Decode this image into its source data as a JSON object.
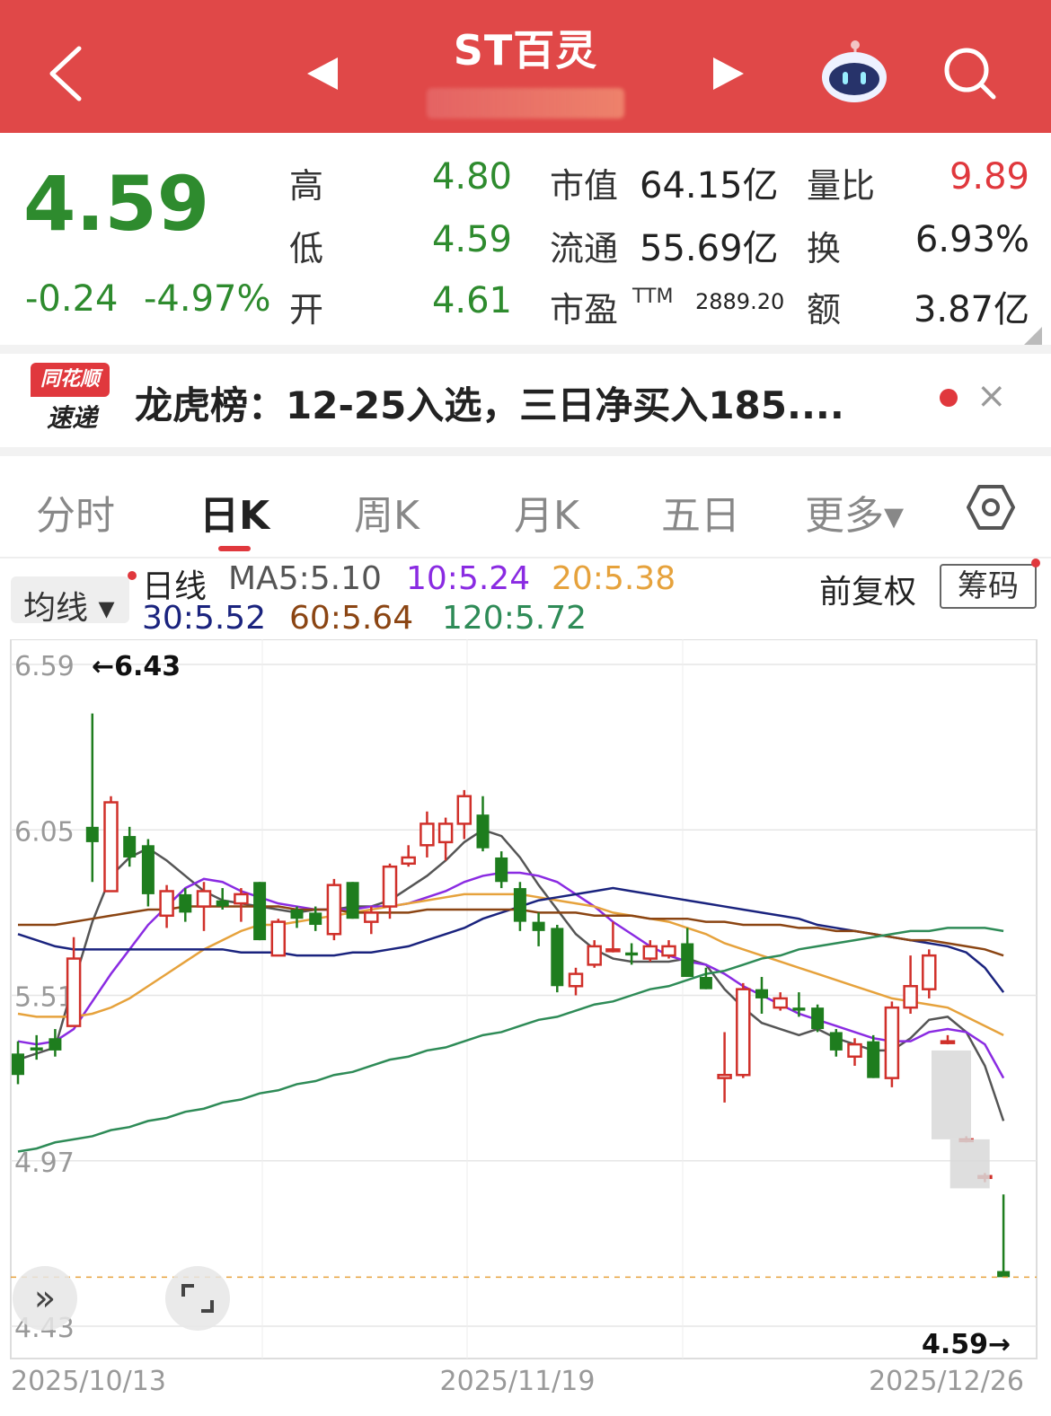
{
  "header": {
    "title": "ST百灵",
    "back_icon": "chevron-left-icon",
    "prev_icon": "triangle-left-icon",
    "next_icon": "triangle-right-icon",
    "robot_icon": "robot-assistant-icon",
    "search_icon": "search-icon"
  },
  "quote": {
    "price": "4.59",
    "change": "-0.24",
    "change_pct": "-4.97%",
    "rows": [
      {
        "label": "高",
        "value": "4.80",
        "mid_label": "市值",
        "mid_value": "64.15亿",
        "right_label": "量比",
        "right_value": "9.89"
      },
      {
        "label": "低",
        "value": "4.59",
        "mid_label": "流通",
        "mid_value": "55.69亿",
        "right_label": "换",
        "right_value": "6.93%"
      },
      {
        "label": "开",
        "value": "4.61",
        "mid_label": "市盈",
        "mid_sup": "TTM",
        "mid_value": "2889.20",
        "right_label": "额",
        "right_value": "3.87亿"
      }
    ],
    "colors": {
      "down": "#2e8b2e",
      "up": "#e0383d"
    }
  },
  "news": {
    "logo_top": "同花顺",
    "logo_bottom": "速递",
    "text": "龙虎榜：12-25入选，三日净买入185....",
    "close": "×"
  },
  "tabs": [
    {
      "label": "分时",
      "active": false
    },
    {
      "label": "日K",
      "active": true
    },
    {
      "label": "周K",
      "active": false
    },
    {
      "label": "月K",
      "active": false
    },
    {
      "label": "五日",
      "active": false
    },
    {
      "label": "更多▾",
      "active": false
    }
  ],
  "settings_icon": "hexagon-settings-icon",
  "ma_bar": {
    "selector": "均线 ▾",
    "line_label": "日线",
    "ma5": "MA5:5.10",
    "ma10": "10:5.24",
    "ma20": "20:5.38",
    "ma30": "30:5.52",
    "ma60": "60:5.64",
    "ma120": "120:5.72",
    "adjust": "前复权",
    "chips": "筹码"
  },
  "overlay": {
    "expand_icon": "double-chevron-right-icon",
    "fullscreen_icon": "fullscreen-icon"
  },
  "chart_data": {
    "type": "candlestick",
    "y_ticks": [
      "6.59",
      "6.05",
      "5.51",
      "4.97",
      "4.43"
    ],
    "ylim": [
      4.43,
      6.59
    ],
    "x_labels": [
      "2025/10/13",
      "2025/11/19",
      "2025/12/26"
    ],
    "max_label": "←6.43",
    "last_label": "4.59→",
    "last_price": 4.59,
    "up_color": "#d0302a",
    "down_color": "#1e7d1e",
    "candles": [
      [
        5.32,
        5.25,
        5.36,
        5.22
      ],
      [
        5.34,
        5.33,
        5.38,
        5.3
      ],
      [
        5.37,
        5.33,
        5.4,
        5.31
      ],
      [
        5.41,
        5.63,
        5.7,
        5.58
      ],
      [
        6.06,
        6.01,
        6.43,
        5.88
      ],
      [
        5.85,
        6.14,
        6.16,
        5.85
      ],
      [
        6.03,
        5.96,
        6.06,
        5.93
      ],
      [
        6.0,
        5.84,
        6.02,
        5.8
      ],
      [
        5.77,
        5.85,
        5.87,
        5.73
      ],
      [
        5.84,
        5.78,
        5.86,
        5.75
      ],
      [
        5.8,
        5.85,
        5.88,
        5.72
      ],
      [
        5.82,
        5.8,
        5.86,
        5.79
      ],
      [
        5.81,
        5.84,
        5.86,
        5.75
      ],
      [
        5.88,
        5.69,
        5.88,
        5.69
      ],
      [
        5.64,
        5.75,
        5.76,
        5.64
      ],
      [
        5.79,
        5.76,
        5.8,
        5.73
      ],
      [
        5.78,
        5.74,
        5.8,
        5.72
      ],
      [
        5.71,
        5.87,
        5.89,
        5.69
      ],
      [
        5.88,
        5.76,
        5.88,
        5.76
      ],
      [
        5.75,
        5.78,
        5.8,
        5.71
      ],
      [
        5.8,
        5.93,
        5.94,
        5.76
      ],
      [
        5.94,
        5.96,
        6.0,
        5.93
      ],
      [
        6.0,
        6.07,
        6.11,
        5.96
      ],
      [
        6.01,
        6.07,
        6.09,
        5.95
      ],
      [
        6.07,
        6.16,
        6.18,
        6.02
      ],
      [
        6.1,
        5.99,
        6.16,
        5.98
      ],
      [
        5.96,
        5.88,
        5.98,
        5.86
      ],
      [
        5.86,
        5.75,
        5.88,
        5.72
      ],
      [
        5.75,
        5.72,
        5.78,
        5.67
      ],
      [
        5.73,
        5.54,
        5.74,
        5.52
      ],
      [
        5.54,
        5.58,
        5.6,
        5.51
      ],
      [
        5.61,
        5.67,
        5.69,
        5.6
      ],
      [
        5.66,
        5.66,
        5.75,
        5.65
      ],
      [
        5.65,
        5.64,
        5.68,
        5.61
      ],
      [
        5.63,
        5.67,
        5.69,
        5.62
      ],
      [
        5.64,
        5.67,
        5.69,
        5.63
      ],
      [
        5.68,
        5.57,
        5.73,
        5.57
      ],
      [
        5.57,
        5.53,
        5.6,
        5.53
      ],
      [
        5.24,
        5.25,
        5.39,
        5.16
      ],
      [
        5.25,
        5.53,
        5.55,
        5.24
      ],
      [
        5.53,
        5.5,
        5.57,
        5.45
      ],
      [
        5.47,
        5.5,
        5.52,
        5.46
      ],
      [
        5.47,
        5.46,
        5.52,
        5.44
      ],
      [
        5.47,
        5.4,
        5.48,
        5.39
      ],
      [
        5.39,
        5.33,
        5.4,
        5.31
      ],
      [
        5.31,
        5.35,
        5.37,
        5.28
      ],
      [
        5.36,
        5.24,
        5.38,
        5.24
      ],
      [
        5.24,
        5.47,
        5.49,
        5.21
      ],
      [
        5.47,
        5.54,
        5.64,
        5.45
      ],
      [
        5.53,
        5.64,
        5.66,
        5.5
      ],
      [
        5.36,
        5.36,
        5.38,
        5.35
      ],
      [
        5.04,
        5.04,
        5.05,
        5.03
      ],
      [
        4.92,
        4.92,
        4.93,
        4.9
      ],
      [
        4.61,
        4.59,
        4.86,
        4.59
      ]
    ],
    "limit_band_candles": [
      [
        5.33,
        5.04
      ],
      [
        5.04,
        4.88
      ]
    ],
    "ma_lines": [
      {
        "label": "MA5",
        "color": "#555555",
        "values": [
          5.3,
          5.32,
          5.34,
          5.55,
          5.75,
          5.9,
          5.96,
          5.99,
          5.95,
          5.9,
          5.85,
          5.82,
          5.81,
          5.8,
          5.79,
          5.78,
          5.79,
          5.79,
          5.8,
          5.8,
          5.82,
          5.86,
          5.9,
          5.95,
          6.01,
          6.05,
          6.03,
          5.96,
          5.87,
          5.79,
          5.71,
          5.66,
          5.63,
          5.62,
          5.62,
          5.62,
          5.63,
          5.61,
          5.53,
          5.47,
          5.42,
          5.4,
          5.38,
          5.4,
          5.37,
          5.35,
          5.33,
          5.33,
          5.37,
          5.43,
          5.44,
          5.39,
          5.28,
          5.1
        ]
      },
      {
        "label": "MA10",
        "color": "#8a2be2",
        "values": [
          5.36,
          5.35,
          5.36,
          5.4,
          5.49,
          5.58,
          5.66,
          5.74,
          5.8,
          5.86,
          5.89,
          5.88,
          5.85,
          5.83,
          5.81,
          5.8,
          5.79,
          5.79,
          5.79,
          5.8,
          5.8,
          5.81,
          5.83,
          5.85,
          5.88,
          5.9,
          5.91,
          5.91,
          5.9,
          5.88,
          5.84,
          5.8,
          5.75,
          5.71,
          5.67,
          5.64,
          5.62,
          5.61,
          5.58,
          5.54,
          5.51,
          5.48,
          5.45,
          5.43,
          5.41,
          5.39,
          5.37,
          5.36,
          5.36,
          5.39,
          5.4,
          5.39,
          5.35,
          5.24
        ]
      },
      {
        "label": "MA20",
        "color": "#e6a23c",
        "values": [
          5.45,
          5.44,
          5.44,
          5.44,
          5.45,
          5.47,
          5.5,
          5.54,
          5.58,
          5.62,
          5.66,
          5.69,
          5.72,
          5.74,
          5.74,
          5.75,
          5.76,
          5.77,
          5.78,
          5.79,
          5.8,
          5.81,
          5.82,
          5.83,
          5.84,
          5.84,
          5.84,
          5.84,
          5.83,
          5.82,
          5.81,
          5.8,
          5.78,
          5.77,
          5.76,
          5.75,
          5.73,
          5.71,
          5.68,
          5.66,
          5.64,
          5.62,
          5.6,
          5.58,
          5.56,
          5.54,
          5.52,
          5.5,
          5.49,
          5.48,
          5.47,
          5.44,
          5.41,
          5.38
        ]
      },
      {
        "label": "MA30",
        "color": "#1a237e",
        "values": [
          5.71,
          5.69,
          5.67,
          5.66,
          5.66,
          5.66,
          5.66,
          5.66,
          5.66,
          5.66,
          5.66,
          5.66,
          5.65,
          5.65,
          5.65,
          5.64,
          5.64,
          5.64,
          5.65,
          5.65,
          5.66,
          5.67,
          5.69,
          5.71,
          5.73,
          5.76,
          5.78,
          5.8,
          5.82,
          5.83,
          5.84,
          5.85,
          5.86,
          5.85,
          5.84,
          5.83,
          5.82,
          5.81,
          5.8,
          5.79,
          5.78,
          5.77,
          5.76,
          5.74,
          5.73,
          5.72,
          5.71,
          5.7,
          5.69,
          5.68,
          5.67,
          5.65,
          5.6,
          5.52
        ]
      },
      {
        "label": "MA60",
        "color": "#8b4513",
        "values": [
          5.74,
          5.74,
          5.74,
          5.75,
          5.76,
          5.77,
          5.78,
          5.79,
          5.79,
          5.8,
          5.8,
          5.8,
          5.8,
          5.8,
          5.8,
          5.79,
          5.79,
          5.79,
          5.78,
          5.78,
          5.78,
          5.78,
          5.79,
          5.79,
          5.79,
          5.79,
          5.79,
          5.79,
          5.78,
          5.78,
          5.78,
          5.77,
          5.77,
          5.77,
          5.76,
          5.76,
          5.76,
          5.75,
          5.75,
          5.74,
          5.74,
          5.74,
          5.73,
          5.73,
          5.72,
          5.72,
          5.71,
          5.7,
          5.69,
          5.69,
          5.68,
          5.67,
          5.66,
          5.64
        ]
      },
      {
        "label": "MA120",
        "color": "#2e8b57",
        "values": [
          5.0,
          5.01,
          5.03,
          5.04,
          5.05,
          5.07,
          5.08,
          5.1,
          5.11,
          5.13,
          5.14,
          5.16,
          5.17,
          5.19,
          5.2,
          5.22,
          5.23,
          5.25,
          5.26,
          5.28,
          5.3,
          5.31,
          5.33,
          5.34,
          5.36,
          5.38,
          5.39,
          5.41,
          5.43,
          5.44,
          5.46,
          5.48,
          5.49,
          5.51,
          5.53,
          5.54,
          5.56,
          5.58,
          5.59,
          5.61,
          5.63,
          5.64,
          5.66,
          5.67,
          5.68,
          5.69,
          5.7,
          5.71,
          5.72,
          5.72,
          5.73,
          5.73,
          5.73,
          5.72
        ]
      }
    ]
  }
}
